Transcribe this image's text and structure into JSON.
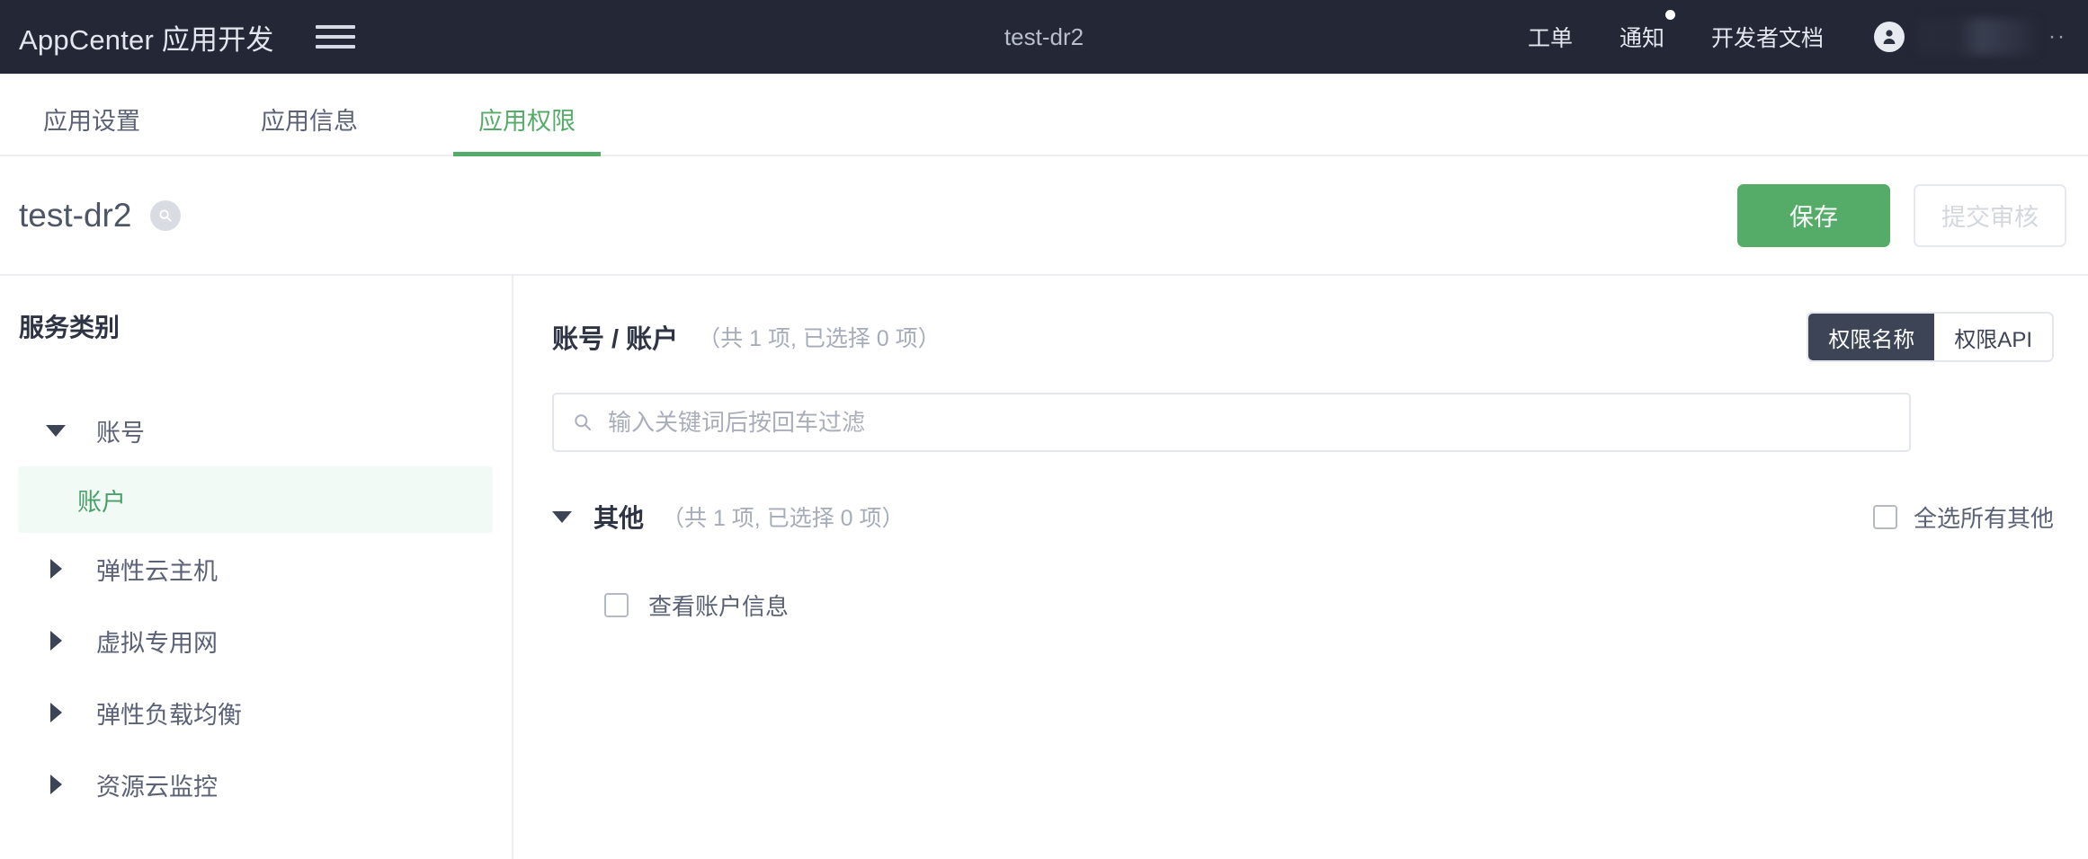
{
  "header": {
    "brand": "AppCenter 应用开发",
    "menu_icon": "hamburger-icon",
    "center_title": "test-dr2",
    "links": [
      {
        "label": "工单",
        "has_dot": false
      },
      {
        "label": "通知",
        "has_dot": true
      },
      {
        "label": "开发者文档",
        "has_dot": false
      }
    ],
    "user_dots": "··"
  },
  "tabs": [
    {
      "label": "应用设置",
      "active": false
    },
    {
      "label": "应用信息",
      "active": false
    },
    {
      "label": "应用权限",
      "active": true
    }
  ],
  "title_row": {
    "app_name": "test-dr2",
    "save_label": "保存",
    "submit_label": "提交审核"
  },
  "sidebar": {
    "heading": "服务类别",
    "items": [
      {
        "label": "账号",
        "expanded": true
      },
      {
        "label": "弹性云主机",
        "expanded": false
      },
      {
        "label": "虚拟专用网",
        "expanded": false
      },
      {
        "label": "弹性负载均衡",
        "expanded": false
      },
      {
        "label": "资源云监控",
        "expanded": false
      }
    ],
    "child": {
      "label": "账户",
      "selected": true
    }
  },
  "main": {
    "breadcrumb": "账号 / 账户",
    "breadcrumb_count": "（共 1 项, 已选择 0 项）",
    "segmented": [
      {
        "label": "权限名称",
        "active": true
      },
      {
        "label": "权限API",
        "active": false
      }
    ],
    "search": {
      "value": "",
      "placeholder": "输入关键词后按回车过滤"
    },
    "group": {
      "title": "其他",
      "count": "（共 1 项, 已选择 0 项）",
      "select_all_label": "全选所有其他",
      "select_all_checked": false
    },
    "permissions": [
      {
        "label": "查看账户信息",
        "checked": false
      }
    ]
  },
  "colors": {
    "header_bg": "#242736",
    "accent_green": "#55ac68",
    "selected_bg": "#f2faf5",
    "segment_active_bg": "#3c4455"
  }
}
